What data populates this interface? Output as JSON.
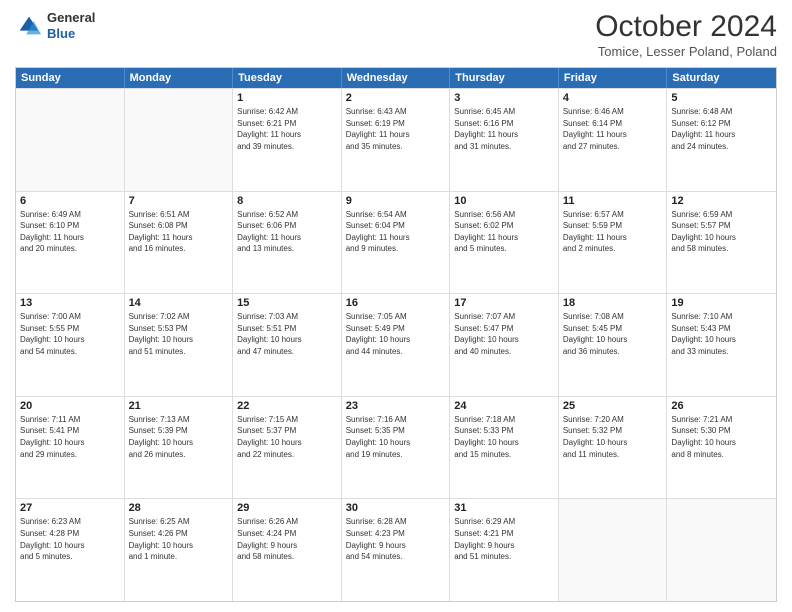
{
  "header": {
    "logo": {
      "general": "General",
      "blue": "Blue"
    },
    "title": "October 2024",
    "subtitle": "Tomice, Lesser Poland, Poland"
  },
  "days_of_week": [
    "Sunday",
    "Monday",
    "Tuesday",
    "Wednesday",
    "Thursday",
    "Friday",
    "Saturday"
  ],
  "weeks": [
    [
      {
        "day": "",
        "info": ""
      },
      {
        "day": "",
        "info": ""
      },
      {
        "day": "1",
        "info": "Sunrise: 6:42 AM\nSunset: 6:21 PM\nDaylight: 11 hours\nand 39 minutes."
      },
      {
        "day": "2",
        "info": "Sunrise: 6:43 AM\nSunset: 6:19 PM\nDaylight: 11 hours\nand 35 minutes."
      },
      {
        "day": "3",
        "info": "Sunrise: 6:45 AM\nSunset: 6:16 PM\nDaylight: 11 hours\nand 31 minutes."
      },
      {
        "day": "4",
        "info": "Sunrise: 6:46 AM\nSunset: 6:14 PM\nDaylight: 11 hours\nand 27 minutes."
      },
      {
        "day": "5",
        "info": "Sunrise: 6:48 AM\nSunset: 6:12 PM\nDaylight: 11 hours\nand 24 minutes."
      }
    ],
    [
      {
        "day": "6",
        "info": "Sunrise: 6:49 AM\nSunset: 6:10 PM\nDaylight: 11 hours\nand 20 minutes."
      },
      {
        "day": "7",
        "info": "Sunrise: 6:51 AM\nSunset: 6:08 PM\nDaylight: 11 hours\nand 16 minutes."
      },
      {
        "day": "8",
        "info": "Sunrise: 6:52 AM\nSunset: 6:06 PM\nDaylight: 11 hours\nand 13 minutes."
      },
      {
        "day": "9",
        "info": "Sunrise: 6:54 AM\nSunset: 6:04 PM\nDaylight: 11 hours\nand 9 minutes."
      },
      {
        "day": "10",
        "info": "Sunrise: 6:56 AM\nSunset: 6:02 PM\nDaylight: 11 hours\nand 5 minutes."
      },
      {
        "day": "11",
        "info": "Sunrise: 6:57 AM\nSunset: 5:59 PM\nDaylight: 11 hours\nand 2 minutes."
      },
      {
        "day": "12",
        "info": "Sunrise: 6:59 AM\nSunset: 5:57 PM\nDaylight: 10 hours\nand 58 minutes."
      }
    ],
    [
      {
        "day": "13",
        "info": "Sunrise: 7:00 AM\nSunset: 5:55 PM\nDaylight: 10 hours\nand 54 minutes."
      },
      {
        "day": "14",
        "info": "Sunrise: 7:02 AM\nSunset: 5:53 PM\nDaylight: 10 hours\nand 51 minutes."
      },
      {
        "day": "15",
        "info": "Sunrise: 7:03 AM\nSunset: 5:51 PM\nDaylight: 10 hours\nand 47 minutes."
      },
      {
        "day": "16",
        "info": "Sunrise: 7:05 AM\nSunset: 5:49 PM\nDaylight: 10 hours\nand 44 minutes."
      },
      {
        "day": "17",
        "info": "Sunrise: 7:07 AM\nSunset: 5:47 PM\nDaylight: 10 hours\nand 40 minutes."
      },
      {
        "day": "18",
        "info": "Sunrise: 7:08 AM\nSunset: 5:45 PM\nDaylight: 10 hours\nand 36 minutes."
      },
      {
        "day": "19",
        "info": "Sunrise: 7:10 AM\nSunset: 5:43 PM\nDaylight: 10 hours\nand 33 minutes."
      }
    ],
    [
      {
        "day": "20",
        "info": "Sunrise: 7:11 AM\nSunset: 5:41 PM\nDaylight: 10 hours\nand 29 minutes."
      },
      {
        "day": "21",
        "info": "Sunrise: 7:13 AM\nSunset: 5:39 PM\nDaylight: 10 hours\nand 26 minutes."
      },
      {
        "day": "22",
        "info": "Sunrise: 7:15 AM\nSunset: 5:37 PM\nDaylight: 10 hours\nand 22 minutes."
      },
      {
        "day": "23",
        "info": "Sunrise: 7:16 AM\nSunset: 5:35 PM\nDaylight: 10 hours\nand 19 minutes."
      },
      {
        "day": "24",
        "info": "Sunrise: 7:18 AM\nSunset: 5:33 PM\nDaylight: 10 hours\nand 15 minutes."
      },
      {
        "day": "25",
        "info": "Sunrise: 7:20 AM\nSunset: 5:32 PM\nDaylight: 10 hours\nand 11 minutes."
      },
      {
        "day": "26",
        "info": "Sunrise: 7:21 AM\nSunset: 5:30 PM\nDaylight: 10 hours\nand 8 minutes."
      }
    ],
    [
      {
        "day": "27",
        "info": "Sunrise: 6:23 AM\nSunset: 4:28 PM\nDaylight: 10 hours\nand 5 minutes."
      },
      {
        "day": "28",
        "info": "Sunrise: 6:25 AM\nSunset: 4:26 PM\nDaylight: 10 hours\nand 1 minute."
      },
      {
        "day": "29",
        "info": "Sunrise: 6:26 AM\nSunset: 4:24 PM\nDaylight: 9 hours\nand 58 minutes."
      },
      {
        "day": "30",
        "info": "Sunrise: 6:28 AM\nSunset: 4:23 PM\nDaylight: 9 hours\nand 54 minutes."
      },
      {
        "day": "31",
        "info": "Sunrise: 6:29 AM\nSunset: 4:21 PM\nDaylight: 9 hours\nand 51 minutes."
      },
      {
        "day": "",
        "info": ""
      },
      {
        "day": "",
        "info": ""
      }
    ]
  ]
}
